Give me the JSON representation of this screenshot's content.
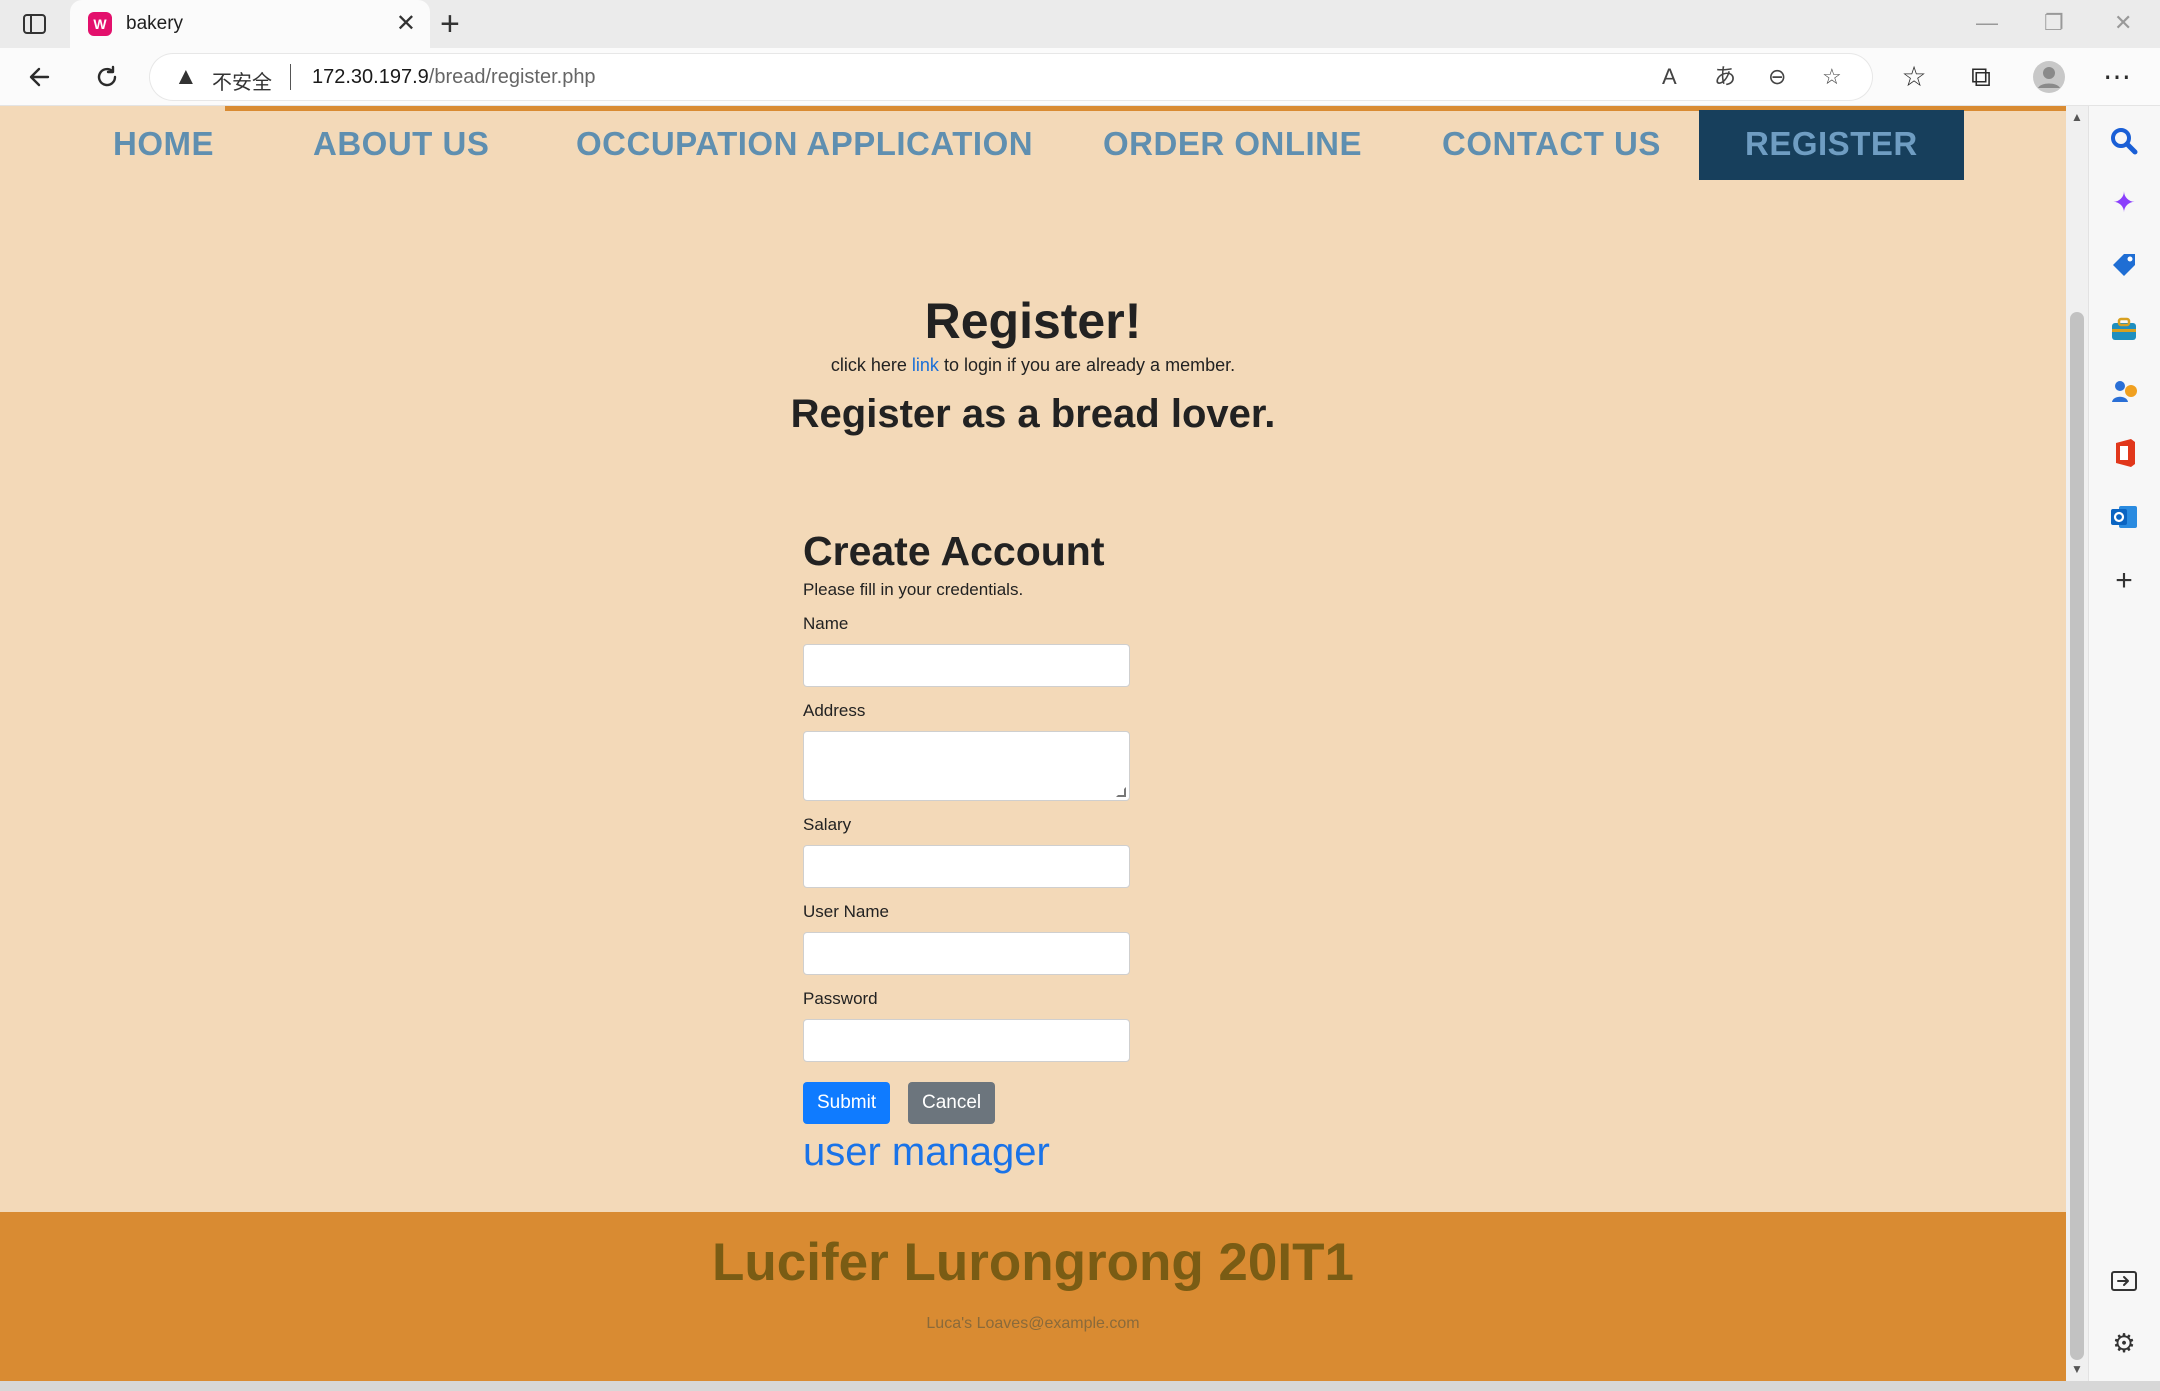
{
  "browser": {
    "tab_title": "bakery",
    "security_label": "不安全",
    "url_host": "172.30.197.9",
    "url_path": "/bread/register.php"
  },
  "nav": {
    "items": [
      "HOME",
      "ABOUT US",
      "OCCUPATION APPLICATION",
      "ORDER ONLINE",
      "CONTACT US",
      "REGISTER"
    ],
    "active": "REGISTER"
  },
  "hero": {
    "title": "Register!",
    "login_prefix": "click here ",
    "login_link": "link",
    "login_suffix": " to login if you are already a member.",
    "subtitle": "Register as a bread lover."
  },
  "form": {
    "heading": "Create Account",
    "subtext": "Please fill in your credentials.",
    "fields": {
      "name": "Name",
      "address": "Address",
      "salary": "Salary",
      "username": "User Name",
      "password": "Password"
    },
    "submit_label": "Submit",
    "cancel_label": "Cancel",
    "user_manager_link": "user manager"
  },
  "footer": {
    "title": "Lucifer Lurongrong 20IT1",
    "email": "Luca's Loaves@example.com"
  },
  "colors": {
    "page_bg": "#f3d9b8",
    "nav_active_bg": "#173f5c",
    "nav_text": "#5f8fb0",
    "footer_bg": "#d98b32",
    "footer_text": "#7a5c14",
    "primary_button": "#0f7bff",
    "secondary_button": "#6c757d"
  }
}
